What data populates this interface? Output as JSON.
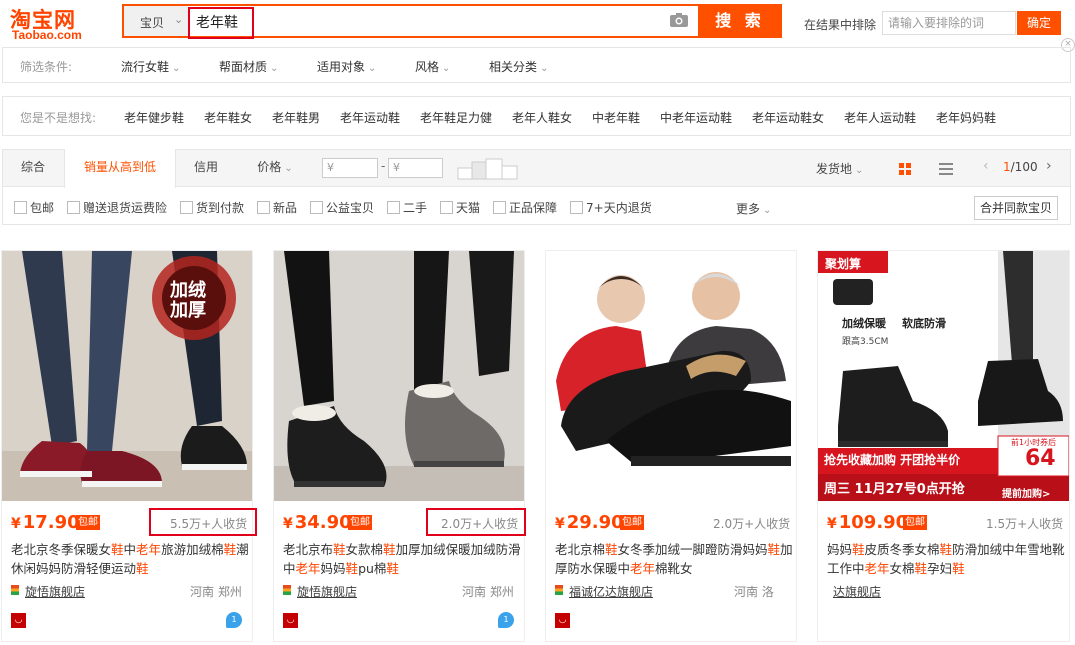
{
  "logo": {
    "cn": "淘宝网",
    "en": "Taobao.com"
  },
  "search": {
    "scope": "宝贝",
    "query": "老年鞋",
    "button": "搜 索"
  },
  "exclude": {
    "label": "在结果中排除",
    "placeholder": "请输入要排除的词",
    "button": "确定"
  },
  "filters": {
    "label": "筛选条件:",
    "items": [
      "流行女鞋",
      "帮面材质",
      "适用对象",
      "风格",
      "相关分类"
    ]
  },
  "suggest": {
    "label": "您是不是想找:",
    "items": [
      "老年健步鞋",
      "老年鞋女",
      "老年鞋男",
      "老年运动鞋",
      "老年鞋足力健",
      "老年人鞋女",
      "中老年鞋",
      "中老年运动鞋",
      "老年运动鞋女",
      "老年人运动鞋",
      "老年妈妈鞋"
    ]
  },
  "sort": {
    "tabs": [
      "综合",
      "销量从高到低",
      "信用"
    ],
    "price_label": "价格",
    "price_min": "¥",
    "price_max": "¥",
    "dash": "-",
    "ship_from": "发货地",
    "page": "1",
    "pages": "/100"
  },
  "checks": [
    "包邮",
    "赠送退货运费险",
    "货到付款",
    "新品",
    "公益宝贝",
    "二手",
    "天猫",
    "正品保障",
    "7+天内退货"
  ],
  "more": "更多",
  "merge": "合并同款宝贝",
  "products": [
    {
      "price": "17.90",
      "baoyou": "包邮",
      "sold": "5.5万+人收货",
      "title_parts": [
        "老北京冬季保暖女",
        "鞋",
        "中",
        "老年",
        "旅游加绒棉",
        "鞋",
        "潮休闲妈妈防滑轻便运动",
        "鞋"
      ],
      "shop": "旋悟旗舰店",
      "loc": "河南 郑州",
      "badge": "加绒加厚",
      "wang": "1"
    },
    {
      "price": "34.90",
      "baoyou": "包邮",
      "sold": "2.0万+人收货",
      "title_parts": [
        "老北京布",
        "鞋",
        "女款棉",
        "鞋",
        "加厚加绒保暖加绒防滑中",
        "老年",
        "妈妈",
        "鞋",
        "pu棉",
        "鞋"
      ],
      "shop": "旋悟旗舰店",
      "loc": "河南 郑州",
      "wang": "1"
    },
    {
      "price": "29.90",
      "baoyou": "包邮",
      "sold": "2.0万+人收货",
      "title_parts": [
        "老北京棉",
        "鞋",
        "女冬季加绒一脚蹬防滑妈妈",
        "鞋",
        "加厚防水保暖中",
        "老年",
        "棉靴女"
      ],
      "shop": "福诚亿达旗舰店",
      "loc": "河南 洛"
    },
    {
      "price": "109.90",
      "baoyou": "包邮",
      "sold": "1.5万+人收货",
      "title_parts": [
        "妈妈",
        "鞋",
        "皮质冬季女棉",
        "鞋",
        "防滑加绒中年雪地靴工作中",
        "老年",
        "女棉",
        "鞋",
        "孕妇",
        "鞋"
      ],
      "shop": "达旗舰店",
      "loc": "",
      "banner1": "聚划算",
      "banner2": "加绒保暖",
      "banner3": "软底防滑",
      "banner4": "跟高3.5CM",
      "promo1": "抢先收藏加购 开团抢半价",
      "promo2": "周三 11月27号0点开抢",
      "promo3": "提前加购>",
      "coupon": "64",
      "coupon_label": "前1小时券后"
    }
  ],
  "colors": {
    "accent": "#ff5000",
    "price": "#ff4400",
    "highlight_box": "#e0001b"
  }
}
